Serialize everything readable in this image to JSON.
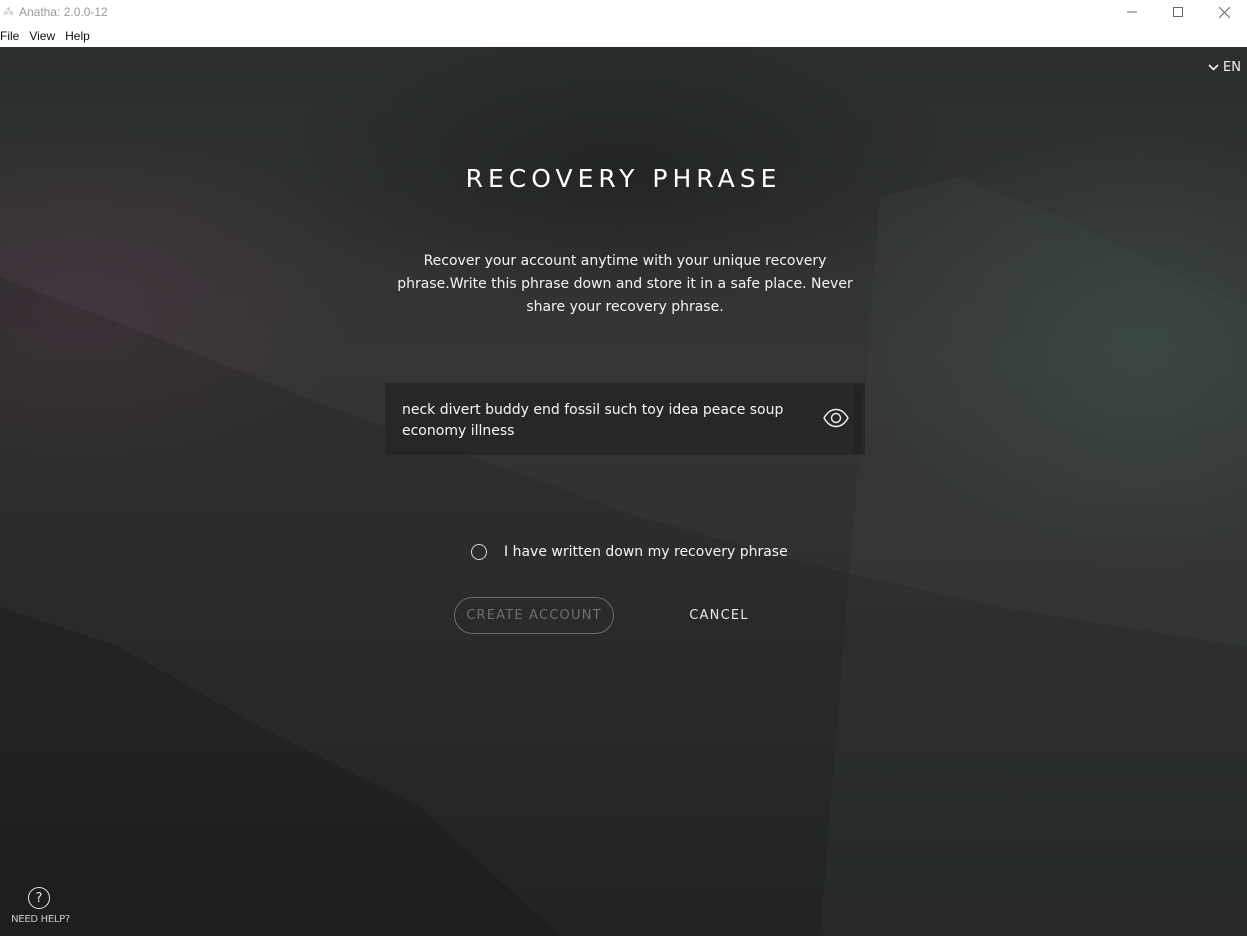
{
  "window": {
    "title": "Anatha: 2.0.0-12",
    "controls": [
      "minimize",
      "maximize",
      "close"
    ]
  },
  "menubar": {
    "items": [
      "File",
      "View",
      "Help"
    ]
  },
  "language": {
    "selected": "EN",
    "icon": "chevron-down-icon"
  },
  "page": {
    "heading": "RECOVERY PHRASE",
    "description": "Recover your account anytime with your unique recovery phrase.Write this phrase down and store it in a safe place. Never share your recovery phrase."
  },
  "phrase": {
    "value": "neck divert buddy end fossil such toy idea peace soup economy illness",
    "toggle_icon": "eye-icon"
  },
  "confirmation": {
    "label": "I have written down my recovery phrase",
    "checked": false
  },
  "actions": {
    "create_label": "CREATE ACCOUNT",
    "create_enabled": false,
    "cancel_label": "CANCEL"
  },
  "help": {
    "label": "NEED HELP?",
    "icon": "question-circle-icon"
  },
  "colors": {
    "text_primary": "#ffffff",
    "button_disabled": "#6f6f6f",
    "background": "#2f3030"
  }
}
